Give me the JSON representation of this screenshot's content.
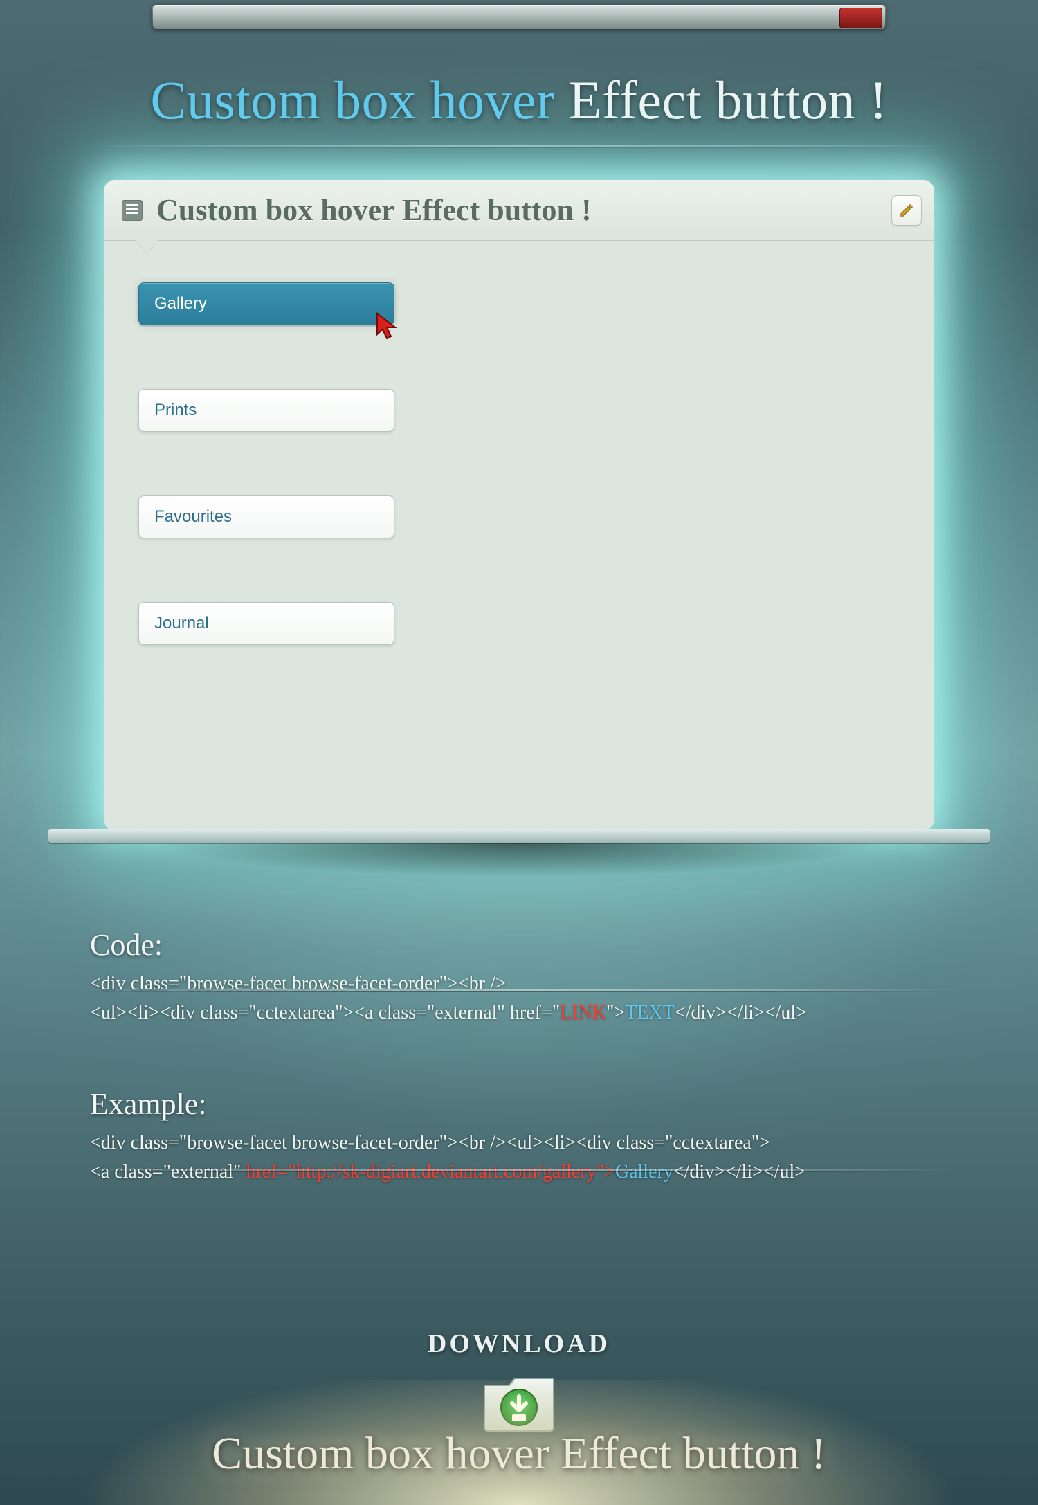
{
  "title": {
    "part_a": "Custom box hover",
    "part_b": "Effect button !"
  },
  "panel": {
    "heading": "Custom box hover Effect button !",
    "buttons": [
      {
        "label": "Gallery",
        "active": true
      },
      {
        "label": "Prints",
        "active": false
      },
      {
        "label": "Favourites",
        "active": false
      },
      {
        "label": "Journal",
        "active": false
      }
    ]
  },
  "code": {
    "heading": "Code:",
    "line1_pre": "<div class=\"browse-facet browse-facet-order\"><br />",
    "line2_pre": "<ul><li><div class=\"cctextarea\"><a class=\"external\" href=\"",
    "line2_link": "LINK",
    "line2_mid": "\">",
    "line2_text": "TEXT",
    "line2_post": "</div></li></ul>"
  },
  "example": {
    "heading": "Example:",
    "line1": "<div class=\"browse-facet browse-facet-order\"><br /><ul><li><div class=\"cctextarea\">",
    "line2_pre": "<a class=\"external\" ",
    "line2_link": "href=\"http://sk-digiart.deviantart.com/gallery\">",
    "line2_text": "Gallery",
    "line2_post": "</div></li></ul>"
  },
  "download": {
    "label": "DOWNLOAD"
  },
  "footer_title": "Custom box hover Effect button !"
}
